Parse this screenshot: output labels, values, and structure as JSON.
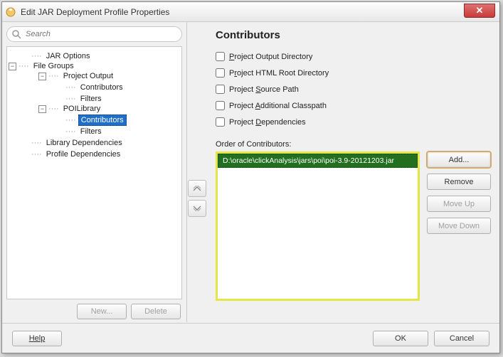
{
  "title": "Edit JAR Deployment Profile Properties",
  "search": {
    "placeholder": "Search"
  },
  "tree": {
    "n1": "JAR Options",
    "n2": "File Groups",
    "n3": "Project Output",
    "n4": "Contributors",
    "n5": "Filters",
    "n6": "POILibrary",
    "n7": "Contributors",
    "n8": "Filters",
    "n9": "Library Dependencies",
    "n10": "Profile Dependencies"
  },
  "leftButtons": {
    "new": "New...",
    "delete": "Delete"
  },
  "panel": {
    "title": "Contributors",
    "cb1_pre": "",
    "cb1_u": "P",
    "cb1_post": "roject Output Directory",
    "cb2_pre": "P",
    "cb2_u": "r",
    "cb2_post": "oject HTML Root Directory",
    "cb3_pre": "Project ",
    "cb3_u": "S",
    "cb3_post": "ource Path",
    "cb4_pre": "Project ",
    "cb4_u": "A",
    "cb4_post": "dditional Classpath",
    "cb5_pre": "Project ",
    "cb5_u": "D",
    "cb5_post": "ependencies",
    "orderLabel": "Order of Contributors:"
  },
  "contributors": {
    "item1": "D:\\oracle\\clickAnalysis\\jars\\poi\\poi-3.9-20121203.jar"
  },
  "listButtons": {
    "add": "Add...",
    "remove": "Remove",
    "moveUp": "Move Up",
    "moveDown": "Move Down"
  },
  "bottom": {
    "help": "Help",
    "ok": "OK",
    "cancel": "Cancel"
  }
}
